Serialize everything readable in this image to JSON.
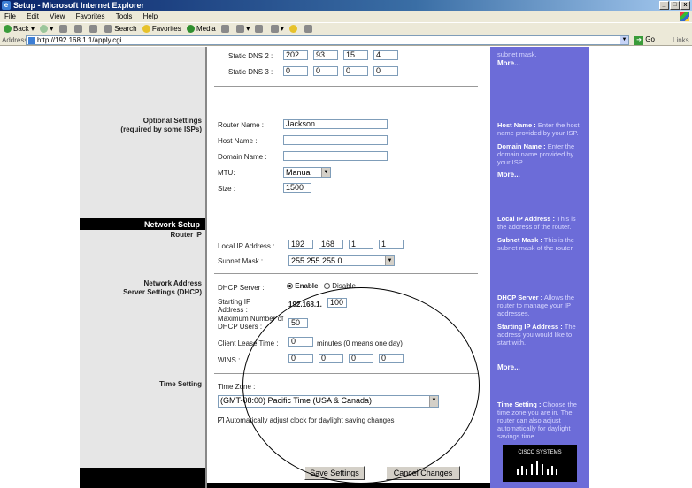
{
  "window": {
    "title": "Setup - Microsoft Internet Explorer",
    "controls": [
      "_",
      "□",
      "x"
    ]
  },
  "menu": [
    "File",
    "Edit",
    "View",
    "Favorites",
    "Tools",
    "Help"
  ],
  "toolbar": {
    "back": "Back",
    "search": "Search",
    "favorites": "Favorites",
    "media": "Media"
  },
  "address": {
    "label": "Address",
    "url": "http://192.168.1.1/apply.cgi",
    "go": "Go",
    "links": "Links"
  },
  "dns": {
    "static_dns2_label": "Static DNS 2 :",
    "static_dns2": [
      "202",
      "93",
      "15",
      "4"
    ],
    "static_dns3_label": "Static DNS 3 :",
    "static_dns3": [
      "0",
      "0",
      "0",
      "0"
    ]
  },
  "optional": {
    "section_label_1": "Optional Settings",
    "section_label_2": "(required by some ISPs)",
    "router_name_label": "Router Name :",
    "router_name": "Jackson",
    "host_name_label": "Host Name :",
    "host_name": "",
    "domain_name_label": "Domain Name :",
    "domain_name": "",
    "mtu_label": "MTU:",
    "mtu": "Manual",
    "size_label": "Size :",
    "size": "1500"
  },
  "network": {
    "header": "Network Setup",
    "router_ip_label": "Router IP",
    "local_ip_label": "Local IP Address :",
    "local_ip": [
      "192",
      "168",
      "1",
      "1"
    ],
    "subnet_label": "Subnet Mask :",
    "subnet": "255.255.255.0"
  },
  "dhcp": {
    "section_label_1": "Network Address",
    "section_label_2": "Server Settings (DHCP)",
    "server_label": "DHCP Server :",
    "enable": "Enable",
    "disable": "Disable",
    "start_label": "Starting IP Address :",
    "start_prefix": "192.168.1.",
    "start_value": "100",
    "max_label": "Maximum Number of DHCP Users :",
    "max_value": "50",
    "lease_label": "Client Lease Time :",
    "lease_value": "0",
    "lease_suffix": "minutes (0 means one day)",
    "wins_label": "WINS :",
    "wins": [
      "0",
      "0",
      "0",
      "0"
    ]
  },
  "time": {
    "section_label": "Time Setting",
    "zone_label": "Time Zone :",
    "zone_value": "(GMT-08:00) Pacific Time (USA & Canada)",
    "auto_dst": "Automatically adjust clock for daylight saving changes"
  },
  "buttons": {
    "save": "Save Settings",
    "cancel": "Cancel Changes"
  },
  "help": {
    "top_text": "subnet mask.",
    "more": "More...",
    "host_title": "Host Name :",
    "host_text": "Enter the host name provided by your ISP.",
    "domain_title": "Domain Name :",
    "domain_text": "Enter the domain name provided by your ISP.",
    "localip_title": "Local IP Address :",
    "localip_text": "This is the address of the router.",
    "subnet_title": "Subnet Mask :",
    "subnet_text": "This is the subnet mask of the router.",
    "dhcp_title": "DHCP Server :",
    "dhcp_text": "Allows the router to manage your IP addresses.",
    "startip_title": "Starting IP Address :",
    "startip_text": "The address you would like to start with.",
    "time_title": "Time Setting :",
    "time_text": "Choose the time zone you are in. The router can also adjust automatically for daylight savings time.",
    "logo": "CISCO SYSTEMS"
  }
}
